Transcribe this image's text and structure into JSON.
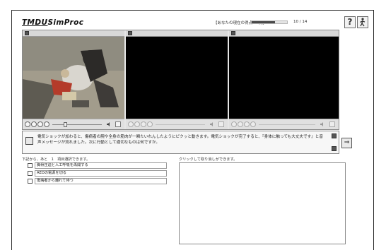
{
  "header": {
    "logo": "TMDU",
    "logo_suffix": "SimProc",
    "score_text": "【あなたの現在の得点 20点】",
    "progress_value": 0.65,
    "page_counter": "10 / 14",
    "help_label": "?",
    "exit_icon": "person-exit-icon"
  },
  "question": {
    "text": "電気ショックが加わると、傷病者の腕や全身の筋肉が一瞬たいれんしたようにピクッと動きます。電気ショックが完了すると、『身体に触っても大丈夫です』と音声メッセージが流れました。次に行動として適切なものは何ですか。"
  },
  "next_button_label": "⇒",
  "answers": {
    "instruction": "下記から、あと　1　項目選択できます。",
    "right_instruction": "クリックして取り消しができます。",
    "choices": [
      "胸骨圧迫と人工呼吸を再開する",
      "AEDの電源を切る",
      "傷病者から離れて待つ"
    ]
  },
  "colors": {
    "video_bg": "#000000",
    "frame": "#2a2a2a",
    "progress_fill": "#4a4a4a"
  }
}
